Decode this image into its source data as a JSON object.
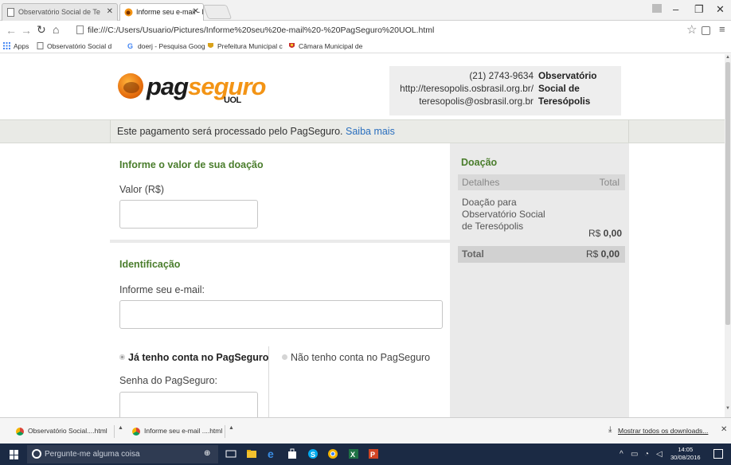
{
  "browser": {
    "tabs": [
      {
        "title": "Observatório Social de Te"
      },
      {
        "title": "Informe seu e-mail - PagS"
      }
    ],
    "url": "file:///C:/Users/Usuario/Pictures/Informe%20seu%20e-mail%20-%20PagSeguro%20UOL.html",
    "bookmarks": [
      {
        "label": "Apps",
        "icon": "apps-grid-icon"
      },
      {
        "label": "Observatório Social d",
        "icon": "page-icon"
      },
      {
        "label": "doerj - Pesquisa Goog",
        "icon": "google-icon"
      },
      {
        "label": "Prefeitura Municipal c",
        "icon": "crest-icon"
      },
      {
        "label": "Câmara Municipal de",
        "icon": "crest-icon"
      }
    ]
  },
  "page": {
    "logo": {
      "pag": "pag",
      "seguro": "seguro",
      "uol": "UOL"
    },
    "merchant": {
      "phone": "(21) 2743-9634",
      "site": "http://teresopolis.osbrasil.org.br/",
      "email": "teresopolis@osbrasil.org.br",
      "name_line1": "Observatório",
      "name_line2": "Social de",
      "name_line3": "Teresópolis"
    },
    "notice": {
      "text": "Este pagamento será processado pelo PagSeguro. ",
      "link": "Saiba mais"
    },
    "value_section": {
      "title": "Informe o valor de sua doação",
      "label": "Valor (R$)",
      "value": ""
    },
    "id_section": {
      "title": "Identificação",
      "email_label": "Informe seu e-mail:",
      "email_value": "",
      "radio_have": "Já tenho conta no PagSeguro",
      "radio_not": "Não tenho conta no PagSeguro",
      "selected": "have",
      "password_label": "Senha do PagSeguro:"
    },
    "summary": {
      "title": "Doação",
      "col_details": "Detalhes",
      "col_total": "Total",
      "item_line1": "Doação para",
      "item_line2": "Observatório Social",
      "item_line3": "de Teresópolis",
      "item_price_prefix": "R$ ",
      "item_price": "0,00",
      "total_label": "Total",
      "total_prefix": "R$ ",
      "total_value": "0,00"
    }
  },
  "downloads": {
    "items": [
      {
        "name": "Observatório Social....html"
      },
      {
        "name": "Informe seu e-mail ....html"
      }
    ],
    "show_all": "Mostrar todos os downloads..."
  },
  "taskbar": {
    "search_placeholder": "Pergunte-me alguma coisa",
    "time": "14:05",
    "date": "30/08/2016"
  },
  "colors": {
    "accent_green": "#4a7d2c",
    "brand_orange": "#f39415",
    "link_blue": "#2a6fbe"
  }
}
